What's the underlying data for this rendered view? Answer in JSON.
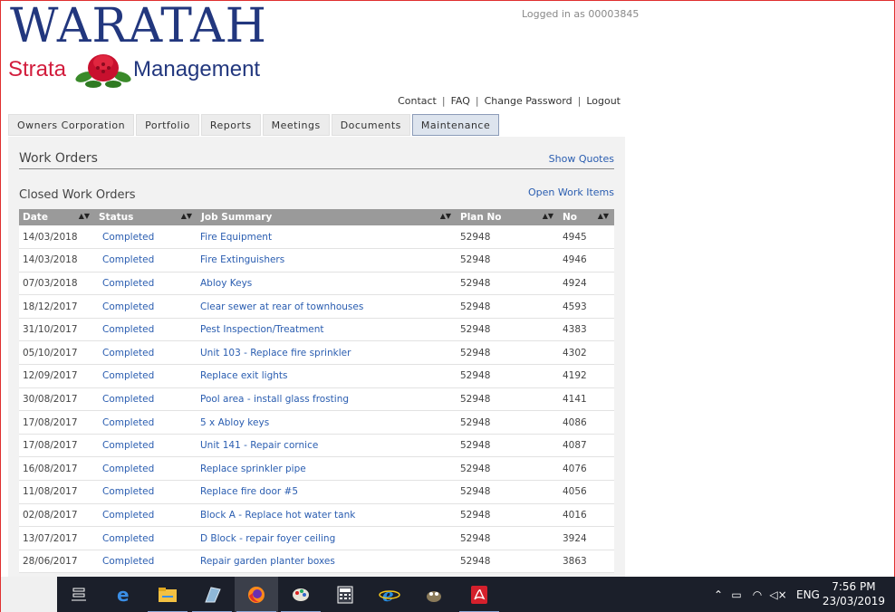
{
  "logo": {
    "main": "WARATAH",
    "left": "Strata",
    "right": "Management"
  },
  "login_info": "Logged in as 00003845",
  "top_links": [
    "Contact",
    "FAQ",
    "Change Password",
    "Logout"
  ],
  "tabs": [
    "Owners Corporation",
    "Portfolio",
    "Reports",
    "Meetings",
    "Documents",
    "Maintenance"
  ],
  "active_tab": "Maintenance",
  "work_orders": {
    "title": "Work Orders",
    "show_quotes": "Show Quotes",
    "closed_title": "Closed Work Orders",
    "open_items": "Open Work Items",
    "columns": [
      "Date",
      "Status",
      "Job Summary",
      "Plan No",
      "No"
    ],
    "rows": [
      [
        "14/03/2018",
        "Completed",
        "Fire Equipment",
        "52948",
        "4945"
      ],
      [
        "14/03/2018",
        "Completed",
        "Fire Extinguishers",
        "52948",
        "4946"
      ],
      [
        "07/03/2018",
        "Completed",
        "Abloy Keys",
        "52948",
        "4924"
      ],
      [
        "18/12/2017",
        "Completed",
        "Clear sewer at rear of townhouses",
        "52948",
        "4593"
      ],
      [
        "31/10/2017",
        "Completed",
        "Pest Inspection/Treatment",
        "52948",
        "4383"
      ],
      [
        "05/10/2017",
        "Completed",
        "Unit 103 - Replace fire sprinkler",
        "52948",
        "4302"
      ],
      [
        "12/09/2017",
        "Completed",
        "Replace exit lights",
        "52948",
        "4192"
      ],
      [
        "30/08/2017",
        "Completed",
        "Pool area - install glass frosting",
        "52948",
        "4141"
      ],
      [
        "17/08/2017",
        "Completed",
        "5 x Abloy keys",
        "52948",
        "4086"
      ],
      [
        "17/08/2017",
        "Completed",
        "Unit 141 - Repair cornice",
        "52948",
        "4087"
      ],
      [
        "16/08/2017",
        "Completed",
        "Replace sprinkler pipe",
        "52948",
        "4076"
      ],
      [
        "11/08/2017",
        "Completed",
        "Replace fire door #5",
        "52948",
        "4056"
      ],
      [
        "02/08/2017",
        "Completed",
        "Block A - Replace hot water tank",
        "52948",
        "4016"
      ],
      [
        "13/07/2017",
        "Completed",
        "D Block - repair foyer ceiling",
        "52948",
        "3924"
      ],
      [
        "28/06/2017",
        "Completed",
        "Repair garden planter boxes",
        "52948",
        "3863"
      ]
    ]
  },
  "taskbar": {
    "icons": [
      "task-view-icon",
      "edge-icon",
      "file-explorer-icon",
      "app-icon",
      "firefox-icon",
      "paint-icon",
      "calculator-icon",
      "internet-explorer-icon",
      "gimp-icon",
      "acrobat-icon"
    ],
    "language": "ENG",
    "time": "7:56 PM",
    "date": "23/03/2019"
  },
  "colors": {
    "brand_blue": "#22377e",
    "brand_red": "#d21c3c",
    "link": "#2a5db0",
    "header_gray": "#9a9a9a"
  }
}
